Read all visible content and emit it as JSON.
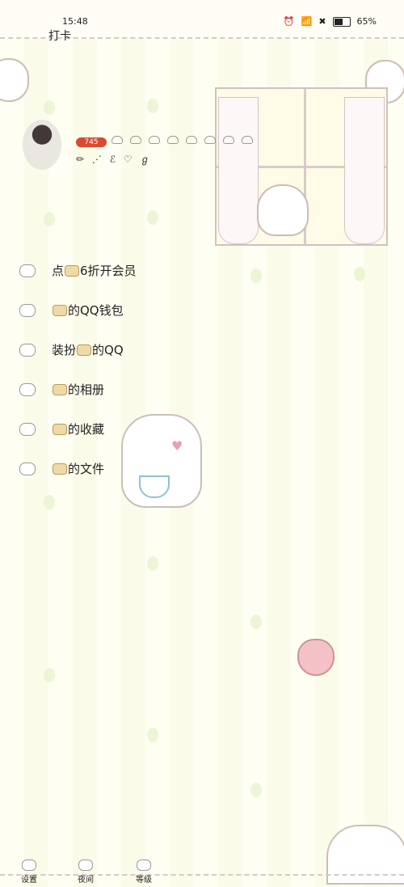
{
  "status_bar": {
    "time": "15:48",
    "battery": "65%"
  },
  "header": {
    "checkin_label": "打卡"
  },
  "profile": {
    "coin_count": "745"
  },
  "menu": {
    "items": [
      {
        "prefix": "点",
        "suffix": "6折开会员"
      },
      {
        "prefix": "",
        "suffix": "的QQ钱包"
      },
      {
        "prefix": "装扮",
        "suffix": "的QQ"
      },
      {
        "prefix": "",
        "suffix": "的相册"
      },
      {
        "prefix": "",
        "suffix": "的收藏"
      },
      {
        "prefix": "",
        "suffix": "的文件"
      }
    ]
  },
  "bottom_bar": {
    "settings": "设置",
    "night_mode": "夜间",
    "level": "等级"
  }
}
